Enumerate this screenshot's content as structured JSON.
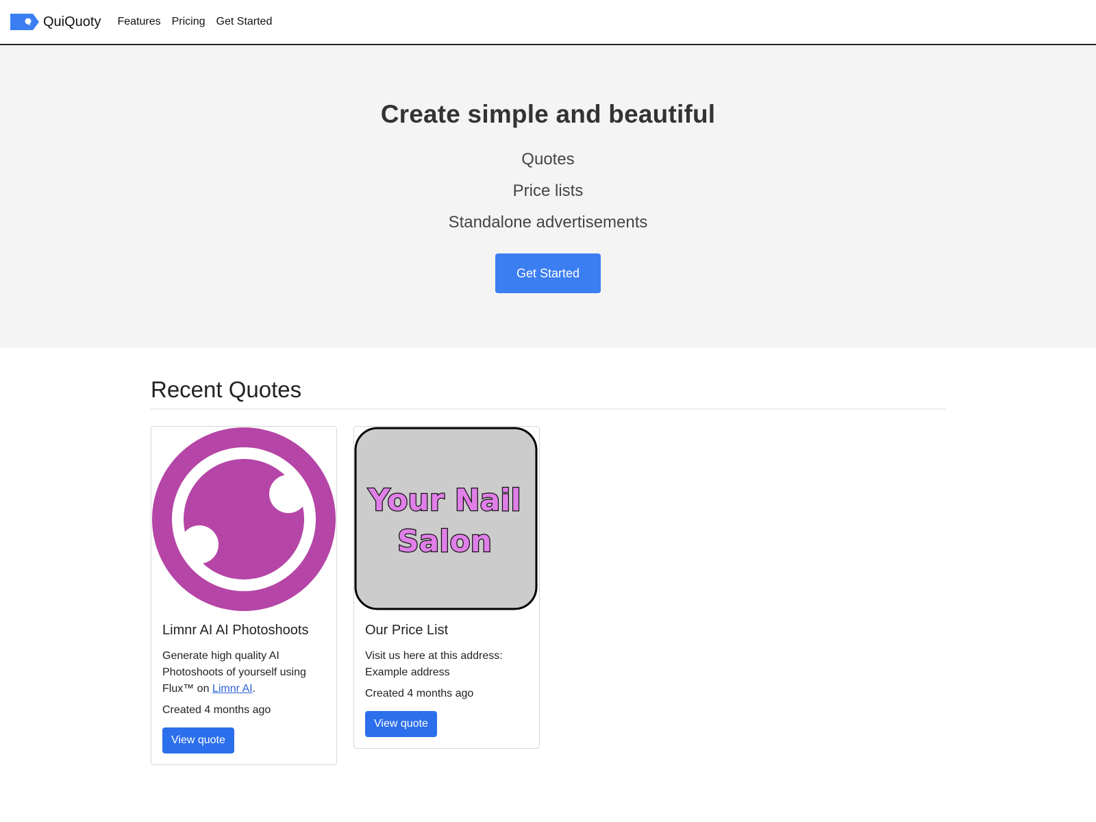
{
  "navbar": {
    "brand": "QuiQuoty",
    "brand_color": "#3b7ef2",
    "links": [
      "Features",
      "Pricing",
      "Get Started"
    ]
  },
  "hero": {
    "title": "Create simple and beautiful",
    "items": [
      "Quotes",
      "Price lists",
      "Standalone advertisements"
    ],
    "cta_label": "Get Started",
    "cta_color": "#3b7ef2"
  },
  "recent": {
    "title": "Recent Quotes",
    "cards": [
      {
        "image": "limnr-logo",
        "image_color": "#b545a6",
        "title": "Limnr AI AI Photoshoots",
        "text_before_link": "Generate high quality AI Photoshoots of yourself using Flux™ on ",
        "link_text": "Limnr AI",
        "text_after_link": ".",
        "created": "Created 4 months ago",
        "button_label": "View quote"
      },
      {
        "image": "nail-salon-logo",
        "image_text_line1": "Your Nail",
        "image_text_line2": "Salon",
        "image_text_color": "#e07fe8",
        "title": "Our Price List",
        "text": "Visit us here at this address: Example address",
        "created": "Created 4 months ago",
        "button_label": "View quote"
      }
    ]
  }
}
